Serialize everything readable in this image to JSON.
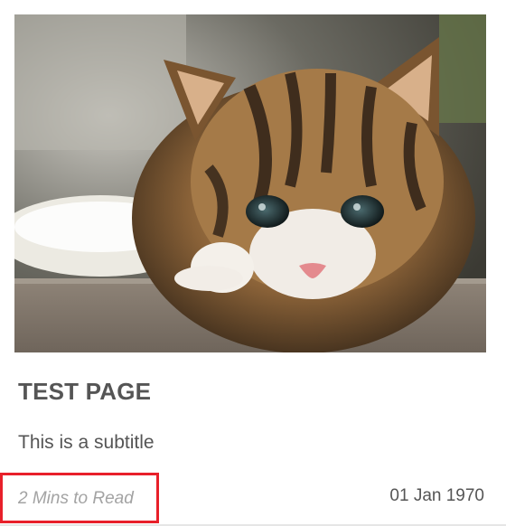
{
  "card": {
    "image_alt": "kitten on countertop",
    "title": "TEST PAGE",
    "subtitle": "This is a subtitle",
    "read_time": "2  Mins to Read",
    "date": "01 Jan 1970"
  },
  "colors": {
    "title_text": "#555555",
    "muted_text": "#a3a3a3",
    "highlight_border": "#e8202a"
  }
}
